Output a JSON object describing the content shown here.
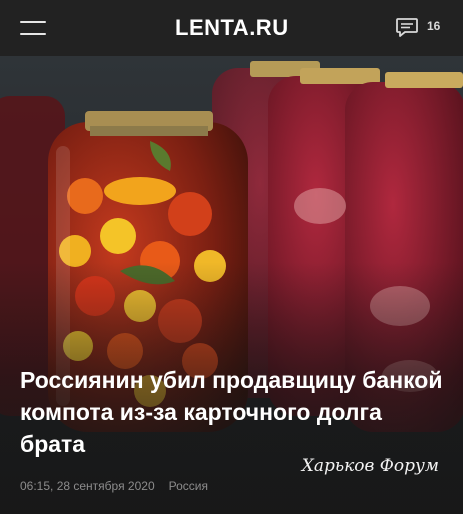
{
  "header": {
    "logo": "LENTA.RU",
    "comments_count": "16",
    "menu_icon": "hamburger-menu-icon",
    "comments_icon": "chat-bubble-icon"
  },
  "article": {
    "headline": "Россиянин убил продавщицу банкой компота из-за карточного долга брата",
    "timestamp": "06:15, 28 сентября 2020",
    "rubric": "Россия",
    "watermark": "Харьков Форум"
  },
  "colors": {
    "header_bg": "#222222",
    "page_bg": "#1f1f1f",
    "headline_text": "#ffffff",
    "meta_text": "#8c8c8c"
  }
}
